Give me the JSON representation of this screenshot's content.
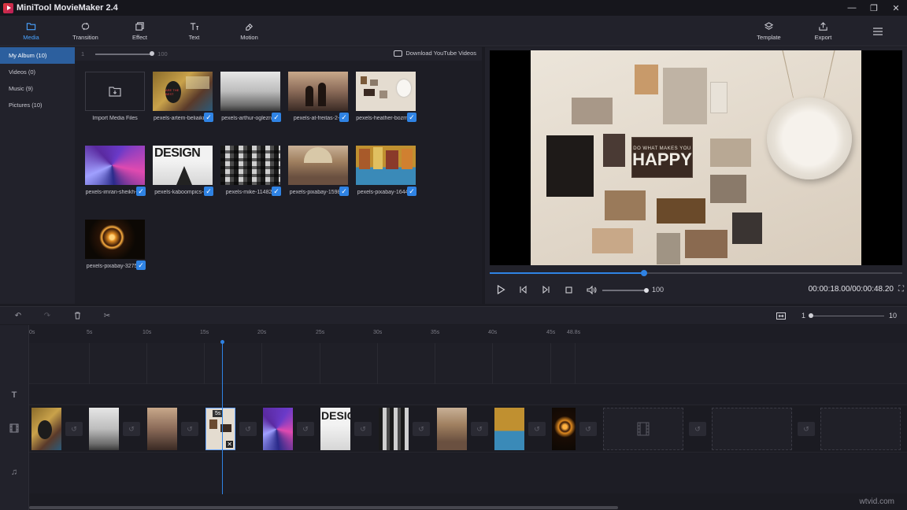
{
  "window": {
    "title": "MiniTool MovieMaker 2.4"
  },
  "toolbar": {
    "media": "Media",
    "transition": "Transition",
    "effect": "Effect",
    "text": "Text",
    "motion": "Motion",
    "template": "Template",
    "export": "Export"
  },
  "sidebar": {
    "items": [
      {
        "label": "My Album",
        "count": "(10)"
      },
      {
        "label": "Videos",
        "count": "(0)"
      },
      {
        "label": "Music",
        "count": "(9)"
      },
      {
        "label": "Pictures",
        "count": "(10)"
      }
    ]
  },
  "media": {
    "zoom_min": "1",
    "zoom_max": "100",
    "download_link": "Download YouTube Videos",
    "import_label": "Import Media Files",
    "files": [
      "pexels-artem-beliaikin...",
      "pexels-arthur-oglezne...",
      "pexels-at-freitas-2-5",
      "pexels-heather-bozma...",
      "pexels-imran-sheikh-2...",
      "pexels-kaboompics-c...",
      "pexels-mike-114820",
      "pexels-pixabay-159862",
      "pexels-pixabay-164455",
      "pexels-pixabay-327509"
    ]
  },
  "preview": {
    "sign_line1": "DO WHAT MAKES YOU",
    "sign_line2": "HAPPY",
    "progress": 0.374,
    "volume": "100",
    "timecode": "00:00:18.00/00:00:48.20"
  },
  "timeline": {
    "zoom_min": "1",
    "zoom_max": "10",
    "ticks": [
      "0s",
      "5s",
      "10s",
      "15s",
      "20s",
      "25s",
      "30s",
      "35s",
      "40s",
      "45s",
      "48.8s"
    ],
    "selected_clip_duration": "5s",
    "clip_design_text": "DESIG"
  },
  "thumb_texts": {
    "design": "DESIGN",
    "sign_small": "ARE THE BEST"
  },
  "watermark": "wtvid.com"
}
